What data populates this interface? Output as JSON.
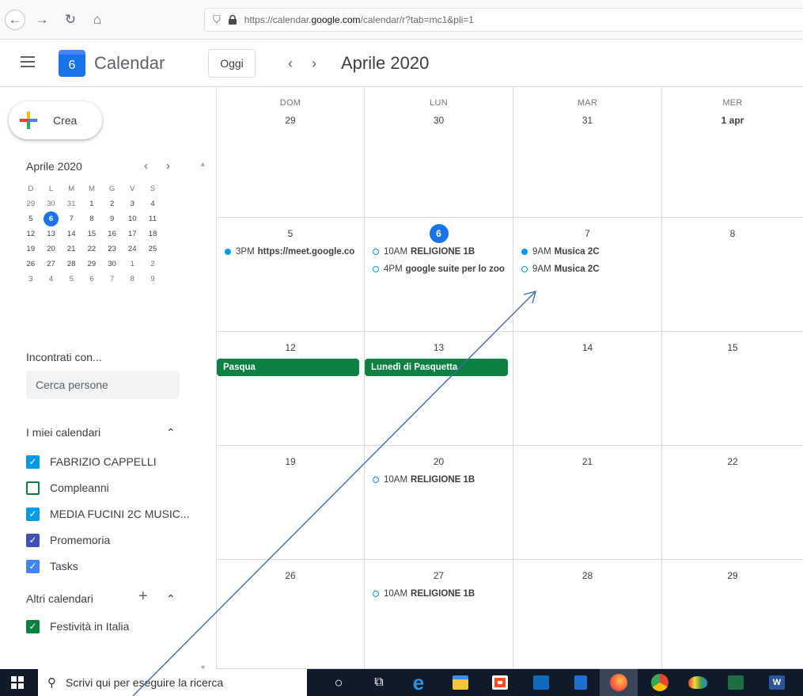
{
  "browser": {
    "url_prefix": "https://calendar.",
    "url_domain": "google.com",
    "url_suffix": "/calendar/r?tab=mc1&pli=1"
  },
  "header": {
    "logo_day": "6",
    "app_title": "Calendar",
    "today_label": "Oggi",
    "prev_label": "‹",
    "next_label": "›",
    "month_title": "Aprile 2020"
  },
  "sidebar": {
    "create_label": "Crea",
    "mini_calendar": {
      "title": "Aprile 2020",
      "prev": "‹",
      "next": "›",
      "dow": [
        "D",
        "L",
        "M",
        "M",
        "G",
        "V",
        "S"
      ],
      "weeks": [
        [
          {
            "d": "29",
            "o": true
          },
          {
            "d": "30",
            "o": true
          },
          {
            "d": "31",
            "o": true
          },
          {
            "d": "1"
          },
          {
            "d": "2"
          },
          {
            "d": "3"
          },
          {
            "d": "4"
          }
        ],
        [
          {
            "d": "5"
          },
          {
            "d": "6",
            "t": true
          },
          {
            "d": "7"
          },
          {
            "d": "8"
          },
          {
            "d": "9"
          },
          {
            "d": "10"
          },
          {
            "d": "11"
          }
        ],
        [
          {
            "d": "12"
          },
          {
            "d": "13"
          },
          {
            "d": "14"
          },
          {
            "d": "15"
          },
          {
            "d": "16"
          },
          {
            "d": "17"
          },
          {
            "d": "18"
          }
        ],
        [
          {
            "d": "19"
          },
          {
            "d": "20"
          },
          {
            "d": "21"
          },
          {
            "d": "22"
          },
          {
            "d": "23"
          },
          {
            "d": "24"
          },
          {
            "d": "25"
          }
        ],
        [
          {
            "d": "26"
          },
          {
            "d": "27"
          },
          {
            "d": "28"
          },
          {
            "d": "29"
          },
          {
            "d": "30"
          },
          {
            "d": "1",
            "o": true
          },
          {
            "d": "2",
            "o": true
          }
        ],
        [
          {
            "d": "3",
            "o": true
          },
          {
            "d": "4",
            "o": true
          },
          {
            "d": "5",
            "o": true
          },
          {
            "d": "6",
            "o": true
          },
          {
            "d": "7",
            "o": true
          },
          {
            "d": "8",
            "o": true
          },
          {
            "d": "9",
            "o": true
          }
        ]
      ]
    },
    "meet_title": "Incontrati con...",
    "search_placeholder": "Cerca persone",
    "my_calendars_title": "I miei calendari",
    "my_calendars": [
      {
        "label": "FABRIZIO CAPPELLI",
        "color": "#039be5",
        "checked": true
      },
      {
        "label": "Compleanni",
        "color": "#0b8043",
        "checked": false
      },
      {
        "label": "MEDIA FUCINI 2C MUSIC...",
        "color": "#039be5",
        "checked": true
      },
      {
        "label": "Promemoria",
        "color": "#3f51b5",
        "checked": true
      },
      {
        "label": "Tasks",
        "color": "#4285f4",
        "checked": true
      }
    ],
    "other_calendars_title": "Altri calendari",
    "other_calendars": [
      {
        "label": "Festività in Italia",
        "color": "#0b8043",
        "checked": true
      }
    ]
  },
  "grid": {
    "dow": [
      "DOM",
      "LUN",
      "MAR",
      "MER"
    ],
    "weeks": [
      {
        "days": [
          {
            "num": "29",
            "events": []
          },
          {
            "num": "30",
            "events": []
          },
          {
            "num": "31",
            "events": []
          },
          {
            "num": "1 apr",
            "bold": true,
            "events": []
          }
        ]
      },
      {
        "days": [
          {
            "num": "5",
            "events": [
              {
                "time": "3PM",
                "title": "https://meet.google.co",
                "style": "filled"
              }
            ]
          },
          {
            "num": "6",
            "today": true,
            "events": [
              {
                "time": "10AM",
                "title": "RELIGIONE 1B",
                "style": "ring"
              },
              {
                "time": "4PM",
                "title": "google suite per lo zoo",
                "style": "ring"
              }
            ]
          },
          {
            "num": "7",
            "events": [
              {
                "time": "9AM",
                "title": "Musica 2C",
                "style": "filled"
              },
              {
                "time": "9AM",
                "title": "Musica 2C",
                "style": "ring"
              }
            ]
          },
          {
            "num": "8",
            "events": []
          }
        ]
      },
      {
        "days": [
          {
            "num": "12",
            "allday": "Pasqua",
            "events": []
          },
          {
            "num": "13",
            "allday": "Lunedì di Pasquetta",
            "events": []
          },
          {
            "num": "14",
            "events": []
          },
          {
            "num": "15",
            "events": []
          }
        ]
      },
      {
        "days": [
          {
            "num": "19",
            "events": []
          },
          {
            "num": "20",
            "events": [
              {
                "time": "10AM",
                "title": "RELIGIONE 1B",
                "style": "ring"
              }
            ]
          },
          {
            "num": "21",
            "events": []
          },
          {
            "num": "22",
            "events": []
          }
        ]
      },
      {
        "days": [
          {
            "num": "26",
            "events": []
          },
          {
            "num": "27",
            "events": [
              {
                "time": "10AM",
                "title": "RELIGIONE 1B",
                "style": "ring"
              }
            ]
          },
          {
            "num": "28",
            "events": []
          },
          {
            "num": "29",
            "events": []
          }
        ]
      }
    ]
  },
  "taskbar": {
    "search_text": "Scrivi qui per eseguire la ricerca"
  },
  "colors": {
    "accent": "#1a73e8",
    "event_blue": "#039be5",
    "holiday_green": "#0b8043",
    "taskbar": "#101b2a"
  }
}
